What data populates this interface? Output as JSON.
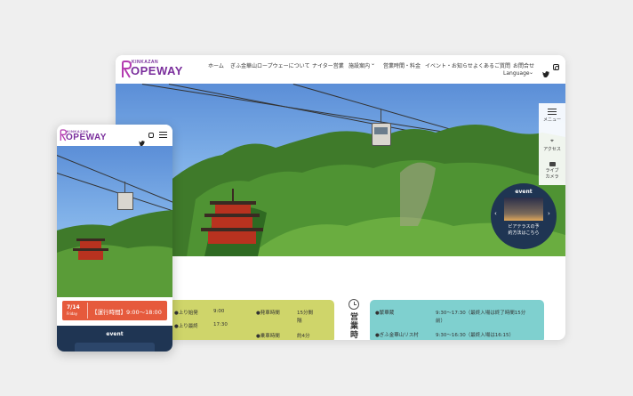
{
  "desktop": {
    "logo_top": "KINKAZAN",
    "logo_main": "OPEWAY",
    "nav": [
      {
        "label": "ホーム"
      },
      {
        "label": "ぎふ金華山ロープウェーについて"
      },
      {
        "label": "ナイター営業"
      },
      {
        "label": "施設案内"
      },
      {
        "label": "営業時間・料金"
      },
      {
        "label": "イベント・お知らせ"
      },
      {
        "label": "よくあるご質問"
      },
      {
        "label": "お問合せ"
      }
    ],
    "language_label": "Language",
    "side_menu": {
      "menu": "メニュー",
      "access": "アクセス",
      "live_camera_line1": "ライブ",
      "live_camera_line2": "カメラ"
    },
    "event_badge": {
      "title": "event",
      "line1": "ビアテラスの予",
      "line2": "約方法はこちら"
    },
    "info_left": [
      {
        "label": "●上り始発",
        "value": "9:00"
      },
      {
        "label": "●上り最終",
        "value": "17:30"
      },
      {
        "label": "●発車時間",
        "value": "15分間"
      },
      {
        "label": "",
        "value": "隔"
      },
      {
        "label": "●乗車時間",
        "value": "約4分"
      }
    ],
    "hours_heading_1": "営",
    "hours_heading_2": "業",
    "hours_heading_3": "時",
    "info_right": [
      {
        "label": "●繁華蔵",
        "value": "9:30～17:30（最終入場は終了時間15分"
      },
      {
        "label": "",
        "value": "前）"
      },
      {
        "label": "●ぎふ金華山リス村",
        "value": "9:30～16:30（最終入場は16:15）"
      }
    ],
    "carousel_dots": 8,
    "carousel_active": 0
  },
  "mobile": {
    "logo_top": "KINKAZAN",
    "logo_main": "OPEWAY",
    "date_top": "7/14",
    "date_bottom": "Friday",
    "hours_text": "【運行時間】9:00～18:00",
    "event_title": "event",
    "carousel_dots": 7
  },
  "colors": {
    "brand_purple": "#7a2e9c",
    "info_yellow": "#cfd56a",
    "info_teal": "#7fd0cf",
    "mobile_orange": "#e65a3c",
    "event_navy": "#1f3553"
  }
}
